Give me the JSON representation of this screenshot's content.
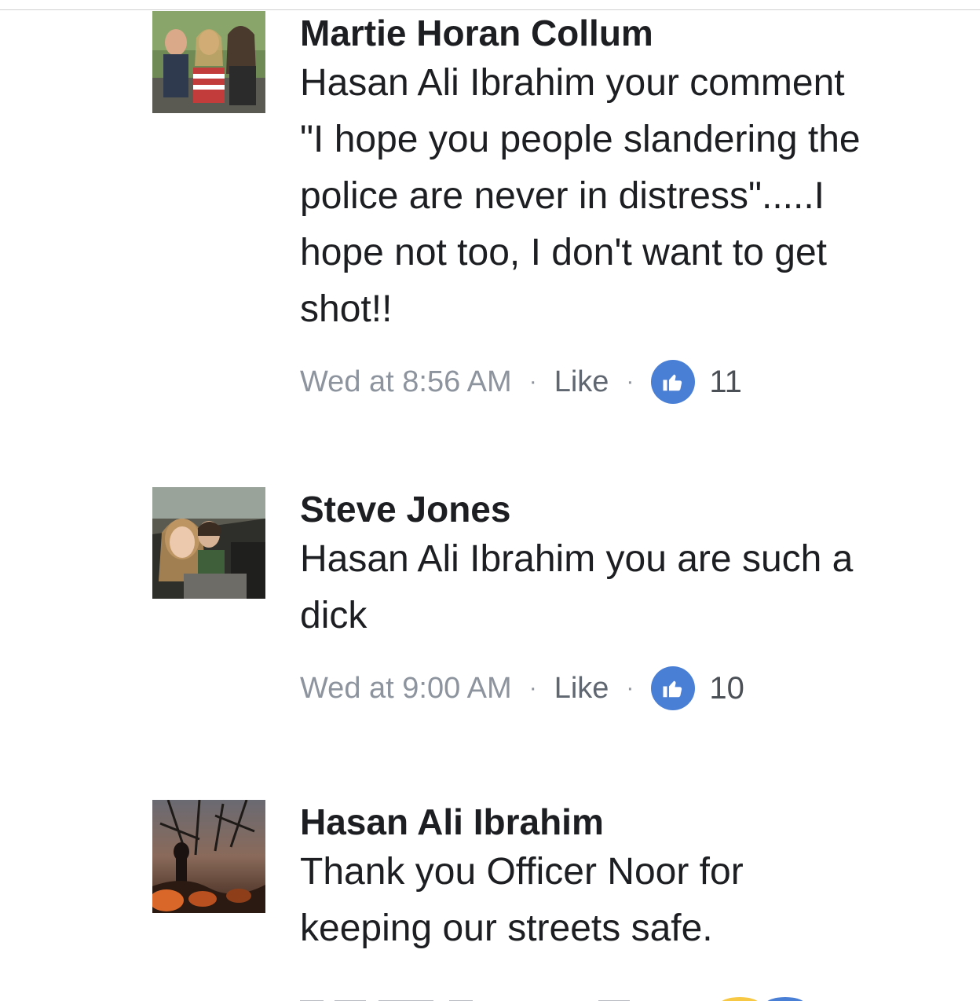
{
  "comments": [
    {
      "author": "Martie Horan Collum",
      "text": "Hasan Ali Ibrahim your comment\n\"I hope you people slandering the\npolice are never in distress\".....I\nhope not too, I don't want to get\nshot!!",
      "time": "Wed at 8:56 AM",
      "like_label": "Like",
      "separator": "·",
      "reaction_count": "11",
      "reaction_icon": "thumbs-up-icon",
      "avatar": "group-photo"
    },
    {
      "author": "Steve Jones",
      "text": "Hasan Ali Ibrahim you are such a\ndick",
      "time": "Wed at 9:00 AM",
      "like_label": "Like",
      "separator": "·",
      "reaction_count": "10",
      "reaction_icon": "thumbs-up-icon",
      "avatar": "children-photo"
    },
    {
      "author": "Hasan Ali Ibrahim",
      "text": "Thank you Officer Noor for\nkeeping our streets safe.",
      "avatar": "sunset-photo"
    }
  ],
  "colors": {
    "author": "#1c1e21",
    "meta": "#8d949e",
    "like_badge": "#4a7fd6",
    "haha_badge": "#f7c844"
  }
}
